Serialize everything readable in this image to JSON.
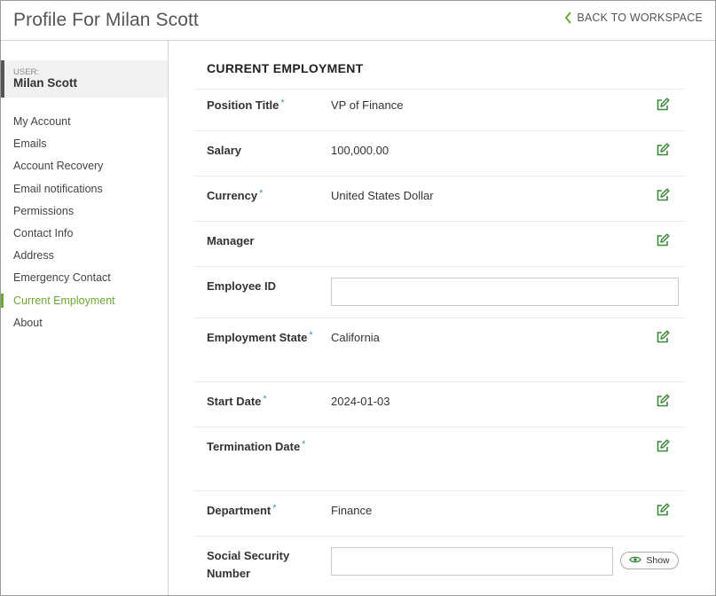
{
  "header": {
    "title": "Profile For Milan Scott",
    "back_link": "BACK TO WORKSPACE"
  },
  "sidebar": {
    "user_label": "USER:",
    "user_name": "Milan Scott",
    "items": [
      {
        "label": "My Account"
      },
      {
        "label": "Emails"
      },
      {
        "label": "Account Recovery"
      },
      {
        "label": "Email notifications"
      },
      {
        "label": "Permissions"
      },
      {
        "label": "Contact Info"
      },
      {
        "label": "Address"
      },
      {
        "label": "Emergency Contact"
      },
      {
        "label": "Current Employment",
        "active": true
      },
      {
        "label": "About"
      }
    ]
  },
  "main": {
    "section_title": "CURRENT EMPLOYMENT",
    "required_marker": "*",
    "fields": {
      "position_title": {
        "label": "Position Title",
        "value": "VP of Finance"
      },
      "salary": {
        "label": "Salary",
        "value": "100,000.00"
      },
      "currency": {
        "label": "Currency",
        "value": "United States Dollar"
      },
      "manager": {
        "label": "Manager",
        "value": ""
      },
      "employee_id": {
        "label": "Employee ID",
        "value": "",
        "placeholder": ""
      },
      "employment_state": {
        "label": "Employment State",
        "value": "California"
      },
      "start_date": {
        "label": "Start Date",
        "value": "2024-01-03"
      },
      "termination_date": {
        "label": "Termination Date",
        "value": ""
      },
      "department": {
        "label": "Department",
        "value": "Finance"
      },
      "ssn": {
        "label": "Social Security Number",
        "value": "",
        "show_label": "Show"
      }
    }
  },
  "colors": {
    "accent_green": "#6aa833",
    "required_blue": "#4a90c2",
    "edit_icon_green": "#3d8a3d"
  }
}
